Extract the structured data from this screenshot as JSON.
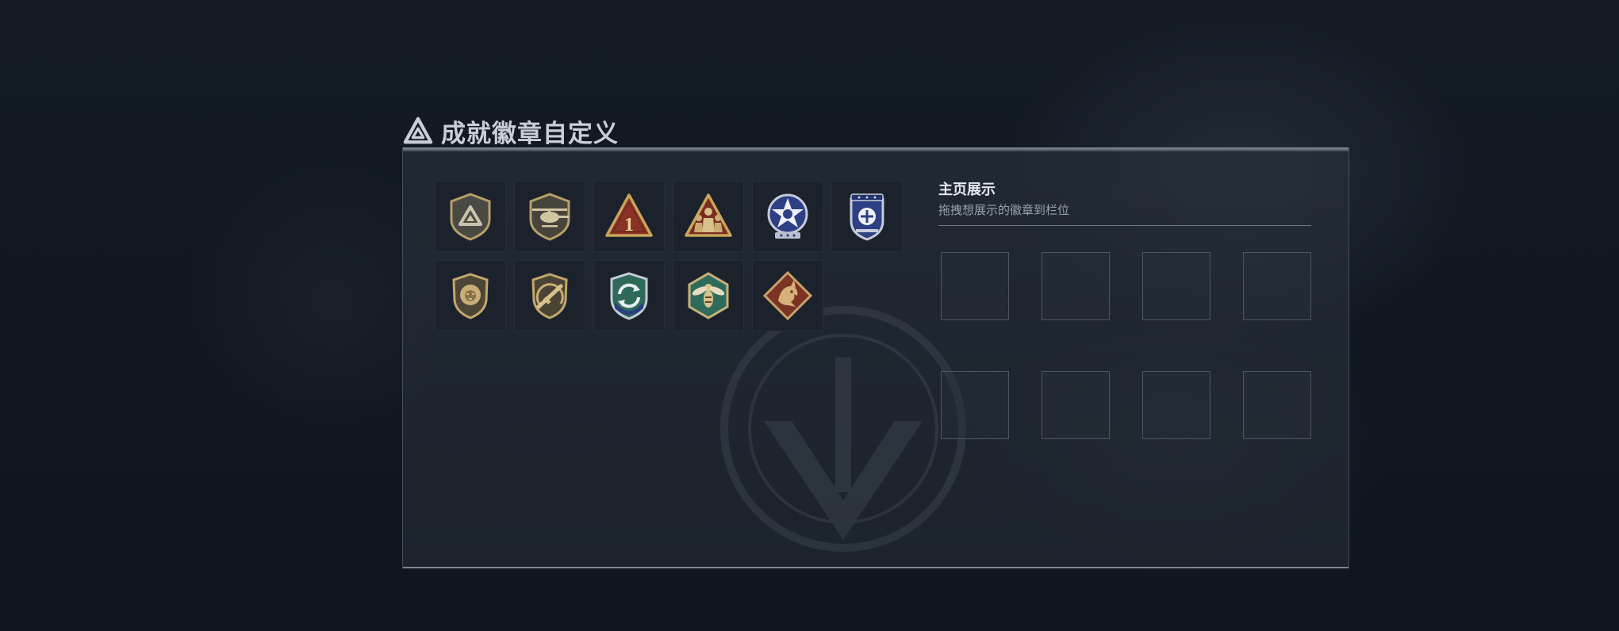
{
  "window": {
    "title": "成就徽章自定义"
  },
  "showcase": {
    "title": "主页展示",
    "subtitle": "拖拽想展示的徽章到栏位",
    "slot_count": 8
  },
  "badges": [
    {
      "icon": "triangle-shield-icon"
    },
    {
      "icon": "helicopter-shield-icon"
    },
    {
      "icon": "number-one-triangle-icon"
    },
    {
      "icon": "soldiers-triangle-icon"
    },
    {
      "icon": "star-skull-round-icon"
    },
    {
      "icon": "blue-crest-shield-icon"
    },
    {
      "icon": "lion-shield-icon"
    },
    {
      "icon": "rifle-shield-icon"
    },
    {
      "icon": "arrows-cycle-shield-icon"
    },
    {
      "icon": "hornet-hexagon-icon"
    },
    {
      "icon": "dragon-diamond-icon"
    }
  ],
  "colors": {
    "gold": "#b8a06a",
    "gold_dark": "#5e4e2e",
    "navy": "#2d3f85",
    "teal": "#2f6b5c",
    "red_brown": "#8a3a2a"
  }
}
